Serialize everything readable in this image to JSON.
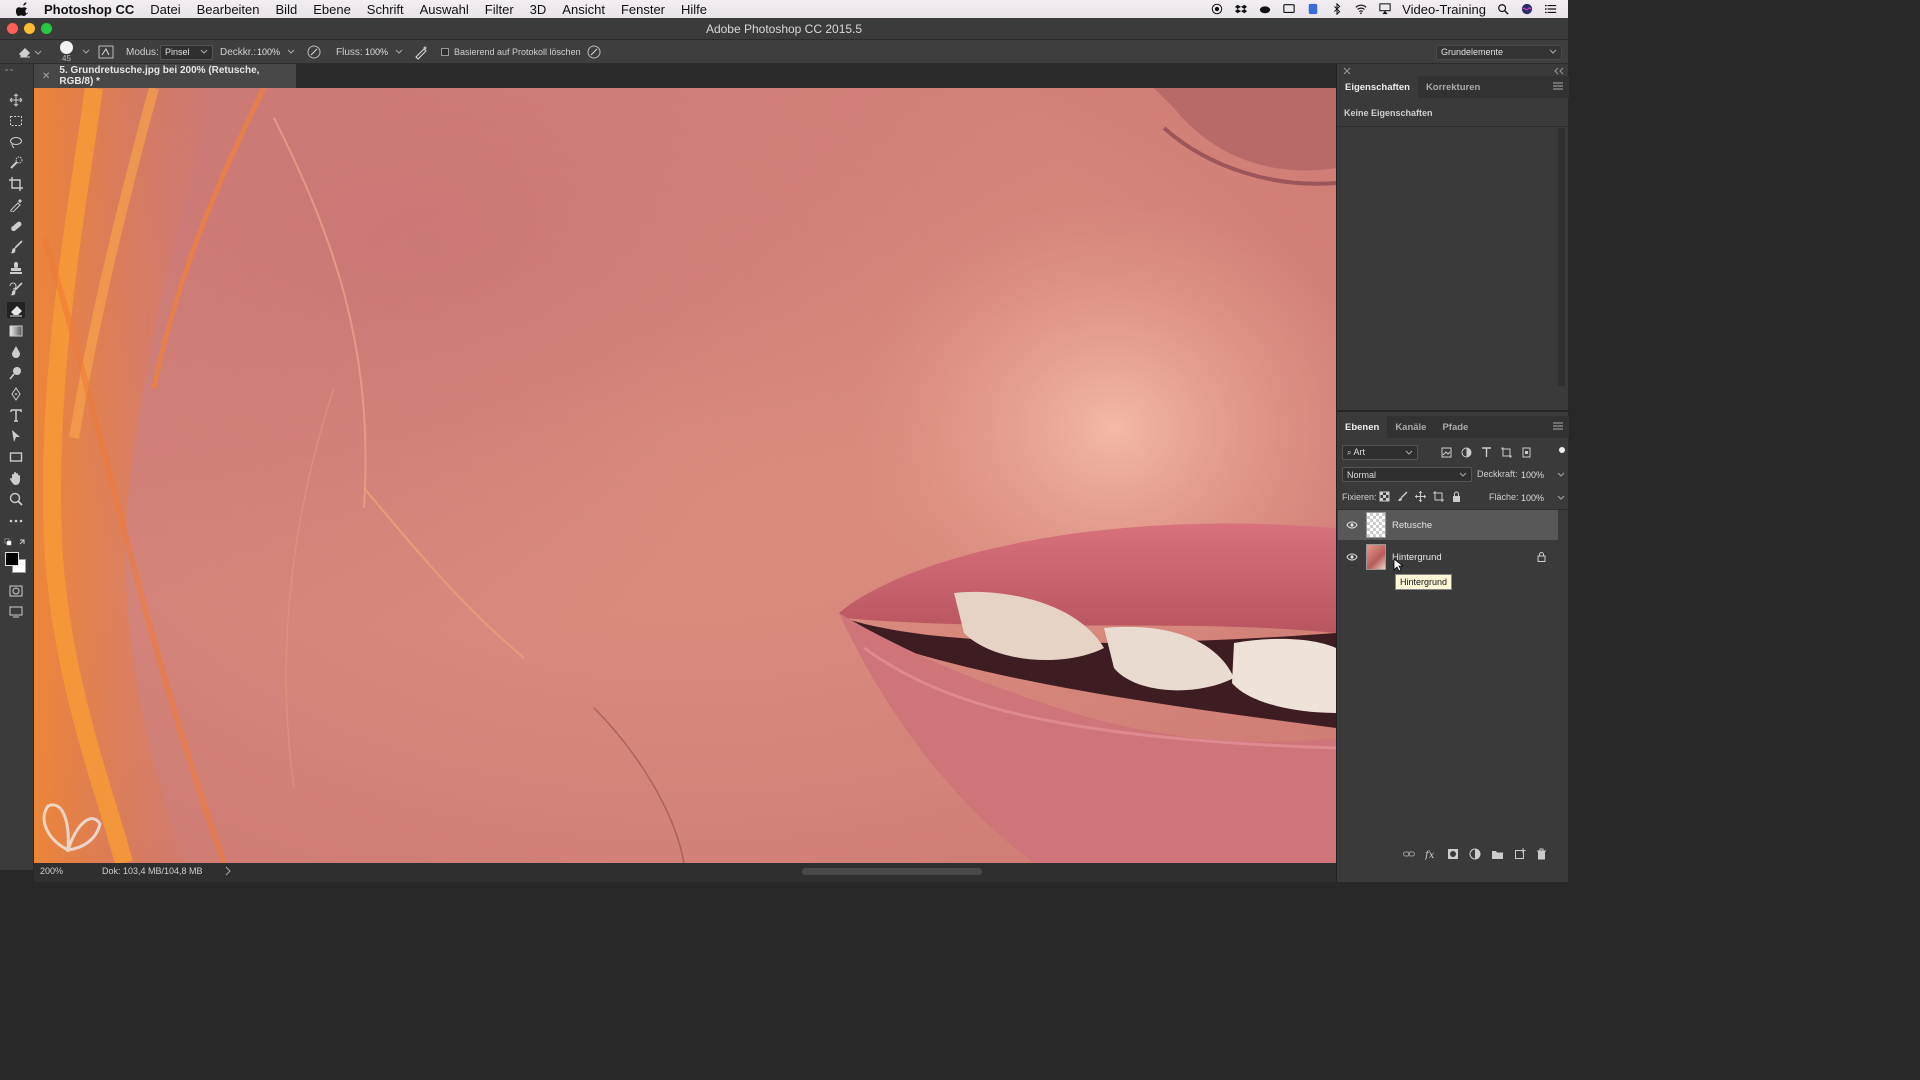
{
  "menubar": {
    "app_name": "Photoshop CC",
    "items": [
      "Datei",
      "Bearbeiten",
      "Bild",
      "Ebene",
      "Schrift",
      "Auswahl",
      "Filter",
      "3D",
      "Ansicht",
      "Fenster",
      "Hilfe"
    ],
    "user": "Video-Training"
  },
  "window": {
    "title": "Adobe Photoshop CC 2015.5"
  },
  "options": {
    "brush_size": "45",
    "mode_label": "Modus:",
    "mode_value": "Pinsel",
    "opacity_label": "Deckkr.:",
    "opacity_value": "100%",
    "flow_label": "Fluss:",
    "flow_value": "100%",
    "history_label": "Basierend auf Protokoll löschen",
    "workspace": "Grundelemente"
  },
  "document": {
    "tab_title": "5. Grundretusche.jpg bei 200% (Retusche, RGB/8) *",
    "zoom": "200%",
    "doc_size": "Dok: 103,4 MB/104,8 MB"
  },
  "properties_panel": {
    "tabs": [
      "Eigenschaften",
      "Korrekturen"
    ],
    "empty_text": "Keine Eigenschaften"
  },
  "layers_panel": {
    "tabs": [
      "Ebenen",
      "Kanäle",
      "Pfade"
    ],
    "filter_kind": "Art",
    "blend_mode": "Normal",
    "opacity_label": "Deckkraft:",
    "opacity_value": "100%",
    "lock_label": "Fixieren:",
    "fill_label": "Fläche:",
    "fill_value": "100%",
    "layers": [
      {
        "name": "Retusche",
        "selected": true,
        "locked": false
      },
      {
        "name": "Hintergrund",
        "selected": false,
        "locked": true
      }
    ],
    "tooltip": "Hintergrund"
  },
  "colors": {
    "accent_red": "#ff5f57",
    "accent_yellow": "#febc2e",
    "accent_green": "#28c840"
  }
}
